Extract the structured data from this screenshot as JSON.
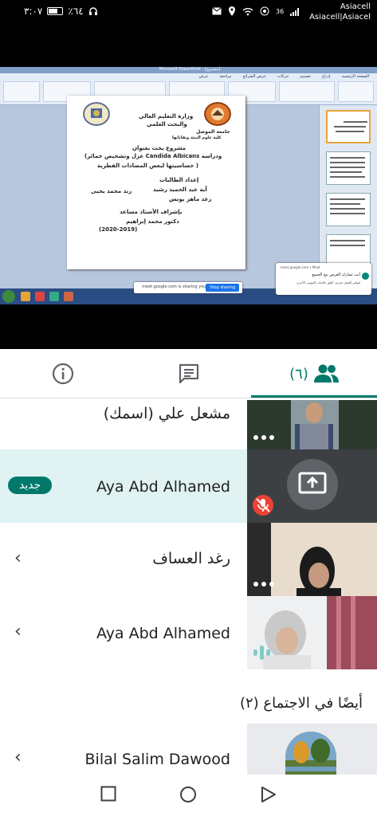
{
  "status_bar": {
    "time": "٣:٠٧",
    "battery": "٪٦٤",
    "carrier_line1": "Asiacell",
    "carrier_line2": "Asiacell|Asiacel",
    "network": "36"
  },
  "presentation": {
    "window_title": "Microsoft PowerPoint - [مشروع]",
    "ribbon_tabs": [
      "الصفحة الرئيسية",
      "إدراج",
      "تصميم",
      "حركات",
      "عرض الشرائح",
      "مراجعة",
      "عرض"
    ],
    "slide": {
      "ministry_line1": "وزارة التعليم العالي",
      "ministry_line2": "والبحث العلمي",
      "university_line1": "جامعة الموصل",
      "university_line2": "كلية علوم البيئة وتقاناتها",
      "project_heading": "مشروع بحث بعنوان",
      "project_title_line1": "(عزل وتشخيص خمائر Candida Albicans ودراسة",
      "project_title_line2": "حساسيتها لبعض المضادات الفطرية )",
      "students_heading": "إعداد الطالبات",
      "student1": "آية عبد الحميد رشيد",
      "student2": "رند محمد يحيى",
      "student3": "رغد ماهر يونس",
      "supervisor_heading": "بإشراف الأستاذ مساعد",
      "supervisor_name": "دكتور محمد إبراهيم",
      "year": "(2020-2019)"
    },
    "sharing_bar_text": "meet.google.com is sharing your screen.",
    "stop_sharing_label": "Stop sharing",
    "notification_title": "meet.google.com • Meet",
    "notification_line1": "أنت تشارك العرض مع الجميع",
    "notification_line2": "لتوفير أفضل تجربة، أغلق علامات التبويب الأخرى"
  },
  "tabs": {
    "info_icon": "info-icon",
    "chat_icon": "chat-icon",
    "people_icon": "people-icon",
    "people_count": "(٦)"
  },
  "participants": [
    {
      "name": "مشعل علي (اسمك)",
      "tile": "video"
    },
    {
      "name": "Aya Abd Alhamed",
      "badge": "جديد",
      "tile": "presenting",
      "muted": true
    },
    {
      "name": "رغد العساف",
      "tile": "video"
    },
    {
      "name": "Aya Abd Alhamed",
      "tile": "video",
      "speaking": true
    }
  ],
  "also_in_meeting": {
    "header": "أيضًا في الاجتماع (٢)",
    "participants": [
      {
        "name": "Bilal Salim Dawood"
      }
    ]
  },
  "colors": {
    "accent": "#00796b",
    "tile_bg": "#3c4043",
    "highlight_row": "#e0f2f1",
    "mute_red": "#ea4335"
  }
}
